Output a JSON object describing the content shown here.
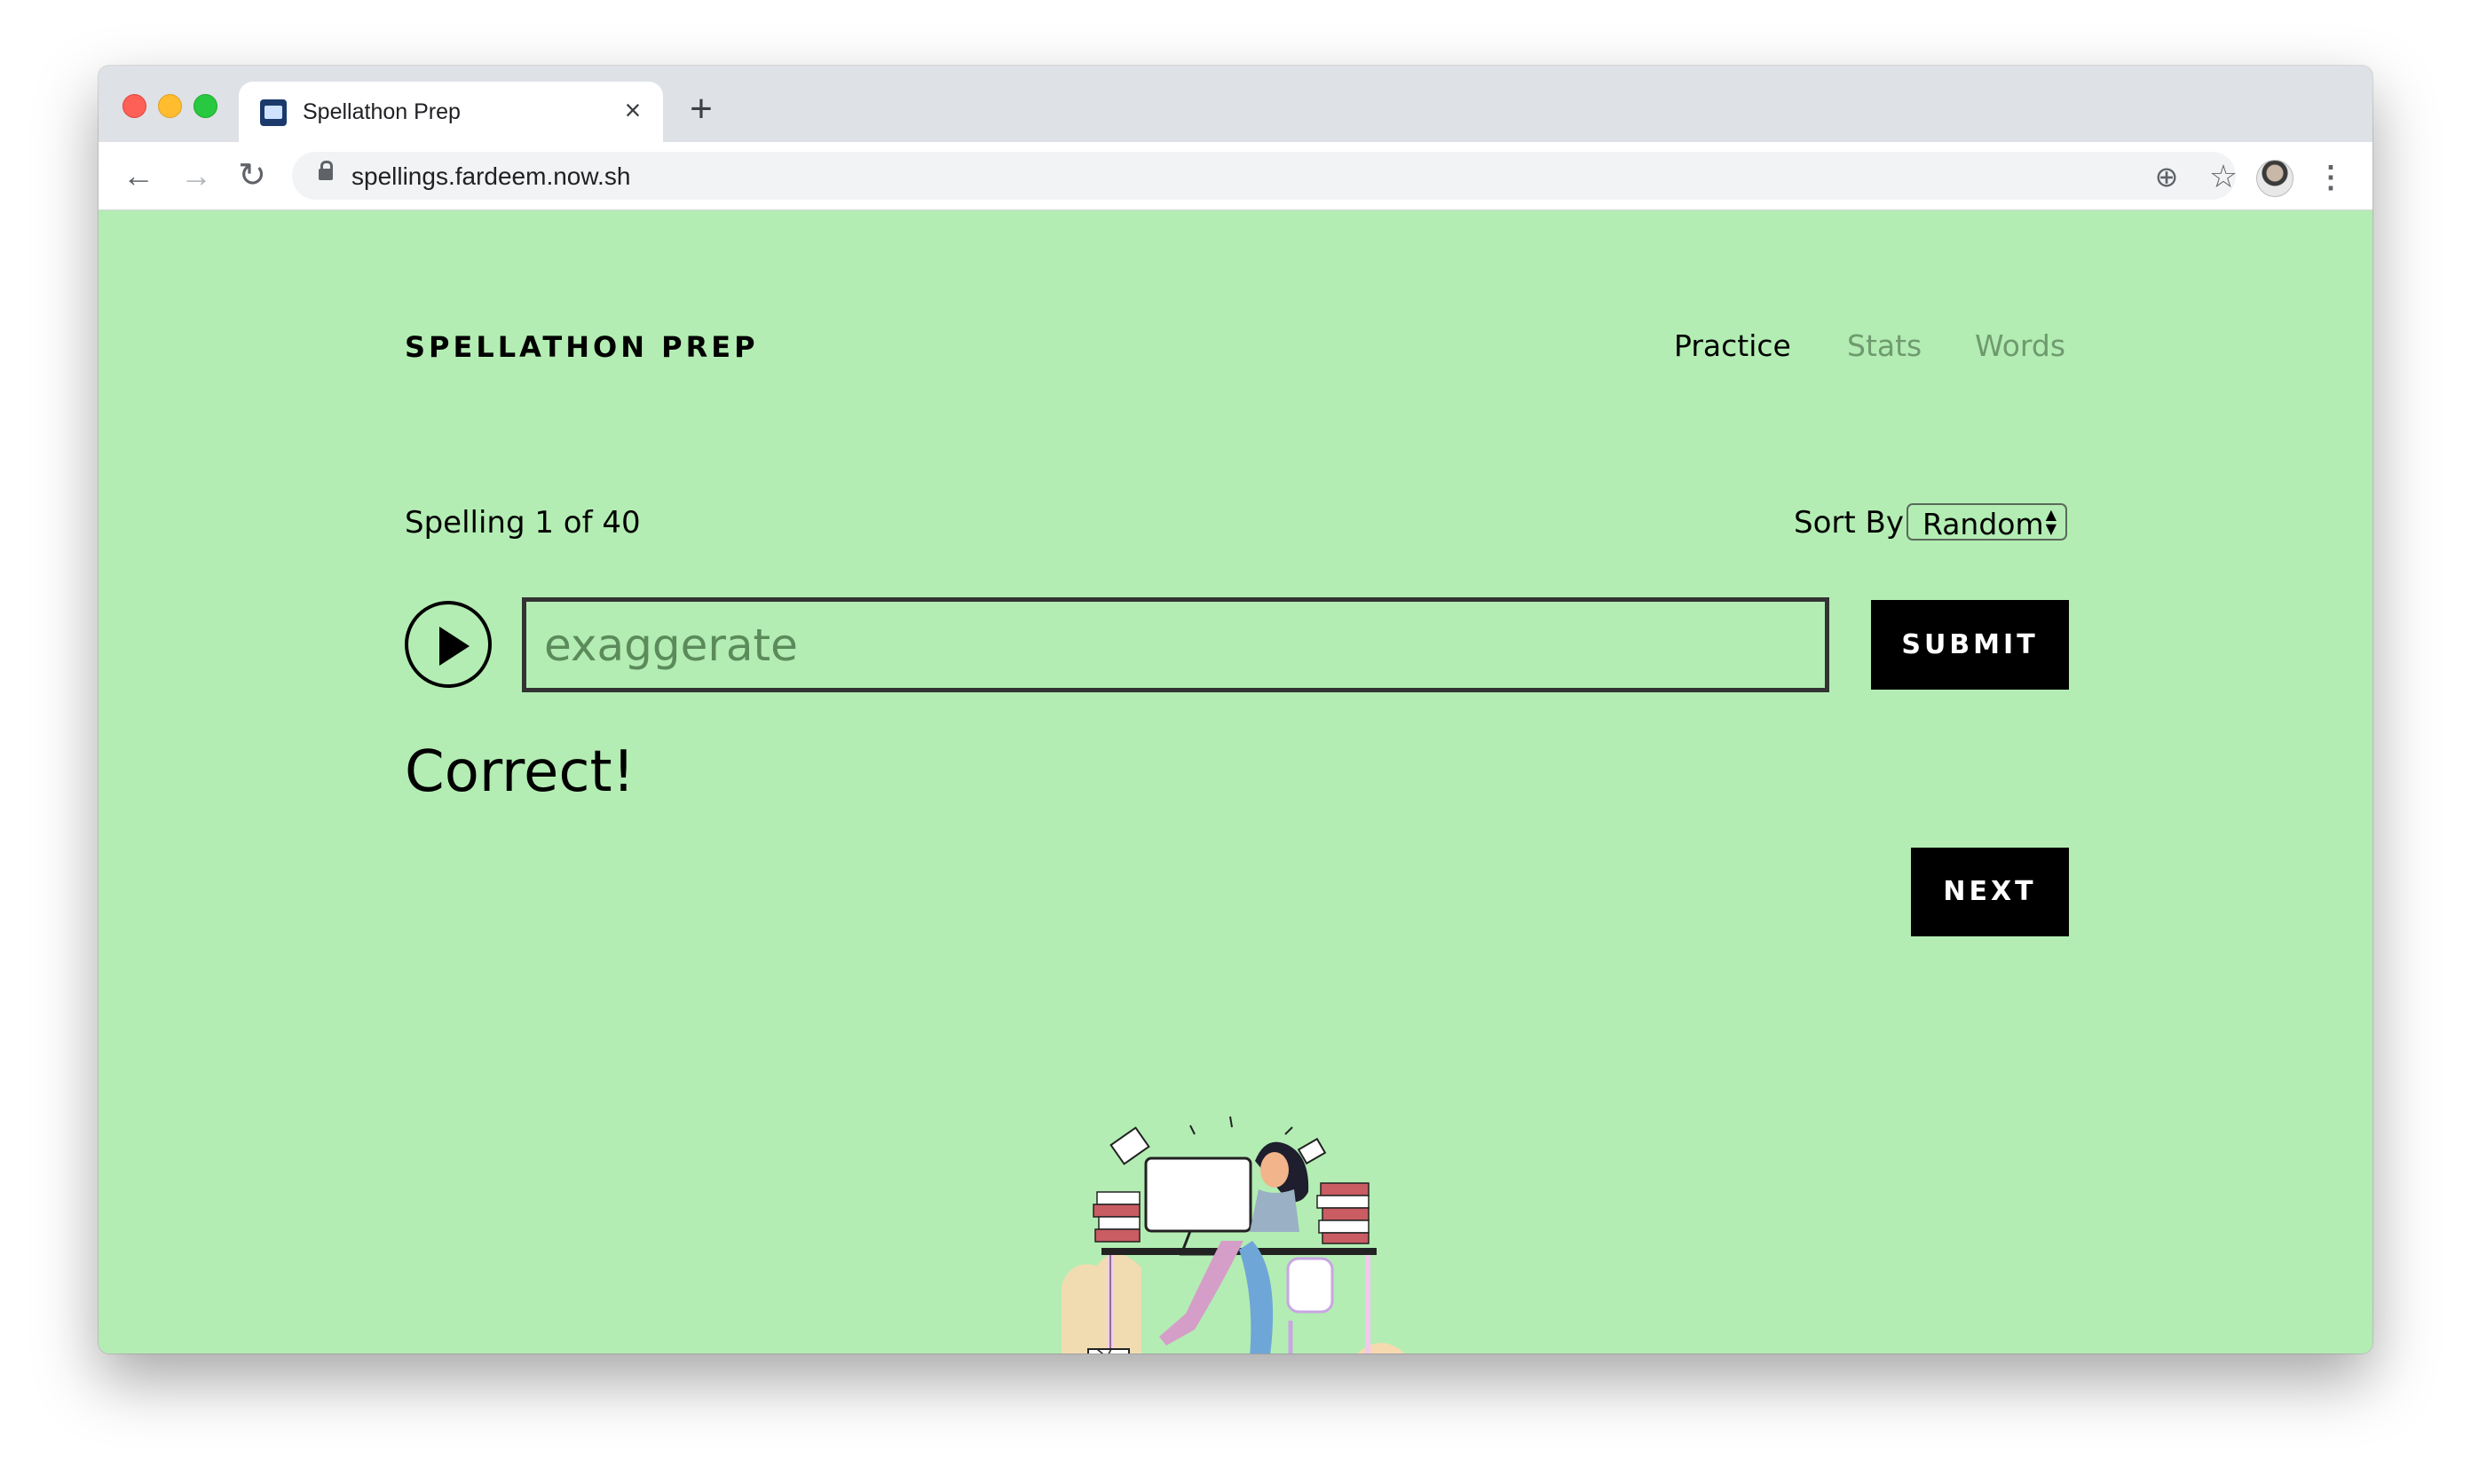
{
  "browser": {
    "tab_title": "Spellathon Prep",
    "tab_close": "×",
    "new_tab": "+",
    "url": "spellings.fardeem.now.sh",
    "back": "←",
    "forward": "→",
    "reload": "↻",
    "install": "⊕",
    "bookmark": "☆",
    "menu": "⋮"
  },
  "header": {
    "brand": "SPELLATHON PREP",
    "nav": [
      {
        "label": "Practice",
        "active": true
      },
      {
        "label": "Stats",
        "active": false
      },
      {
        "label": "Words",
        "active": false
      }
    ]
  },
  "practice": {
    "counter": "Spelling 1 of 40",
    "sort_label": "Sort By",
    "sort_value": "Random",
    "sort_arrows": "▲▼",
    "input_value": "exaggerate",
    "submit_label": "SUBMIT",
    "result": "Correct!",
    "next_label": "NEXT"
  },
  "colors": {
    "page_background": "#b3edb3",
    "button_background": "#000000",
    "inactive_nav": "#6f9a6f"
  }
}
